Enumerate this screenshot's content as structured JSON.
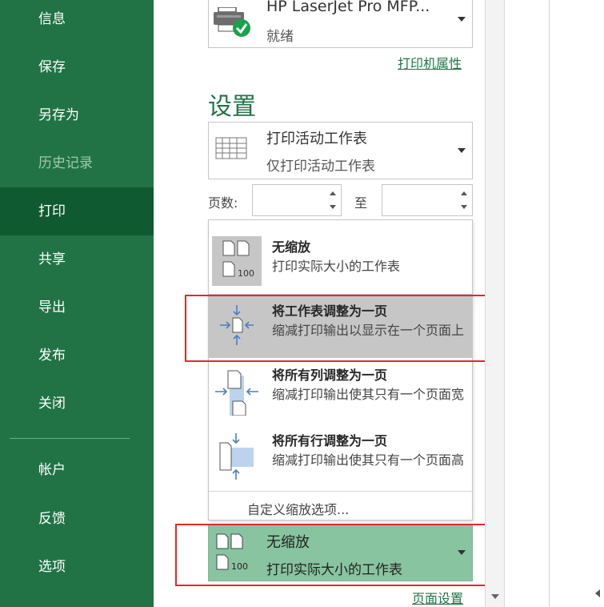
{
  "sidebar": {
    "items": [
      {
        "label": "信息"
      },
      {
        "label": "保存"
      },
      {
        "label": "另存为"
      },
      {
        "label": "历史记录"
      },
      {
        "label": "打印"
      },
      {
        "label": "共享"
      },
      {
        "label": "导出"
      },
      {
        "label": "发布"
      },
      {
        "label": "关闭"
      },
      {
        "label": "帐户"
      },
      {
        "label": "反馈"
      },
      {
        "label": "选项"
      }
    ],
    "active": "打印",
    "disabled": "历史记录"
  },
  "printer": {
    "name": "HP LaserJet Pro MFP...",
    "status": "就绪",
    "properties_link": "打印机属性"
  },
  "settings": {
    "title": "设置",
    "what_to_print": {
      "title": "打印活动工作表",
      "subtitle": "仅打印活动工作表"
    },
    "pages_label": "页数:",
    "to_label": "至",
    "from_value": "",
    "to_value": ""
  },
  "scaling_menu": {
    "options": [
      {
        "title": "无缩放",
        "desc": "打印实际大小的工作表",
        "badge": "100"
      },
      {
        "title": "将工作表调整为一页",
        "desc": "缩减打印输出以显示在一个页面上"
      },
      {
        "title": "将所有列调整为一页",
        "desc": "缩减打印输出使其只有一个页面宽"
      },
      {
        "title": "将所有行调整为一页",
        "desc": "缩减打印输出使其只有一个页面高"
      }
    ],
    "custom_label": "自定义缩放选项...",
    "highlighted_index": 1
  },
  "selected_scaling": {
    "title": "无缩放",
    "desc": "打印实际大小的工作表",
    "badge": "100"
  },
  "page_setup_link": "页面设置",
  "colors": {
    "sidebar": "#217346",
    "sidebar_active": "#0f5a31",
    "accent": "#217346",
    "selected": "#88c4a0",
    "highlight": "#c6c6c6",
    "annotation": "#e02a2a"
  }
}
